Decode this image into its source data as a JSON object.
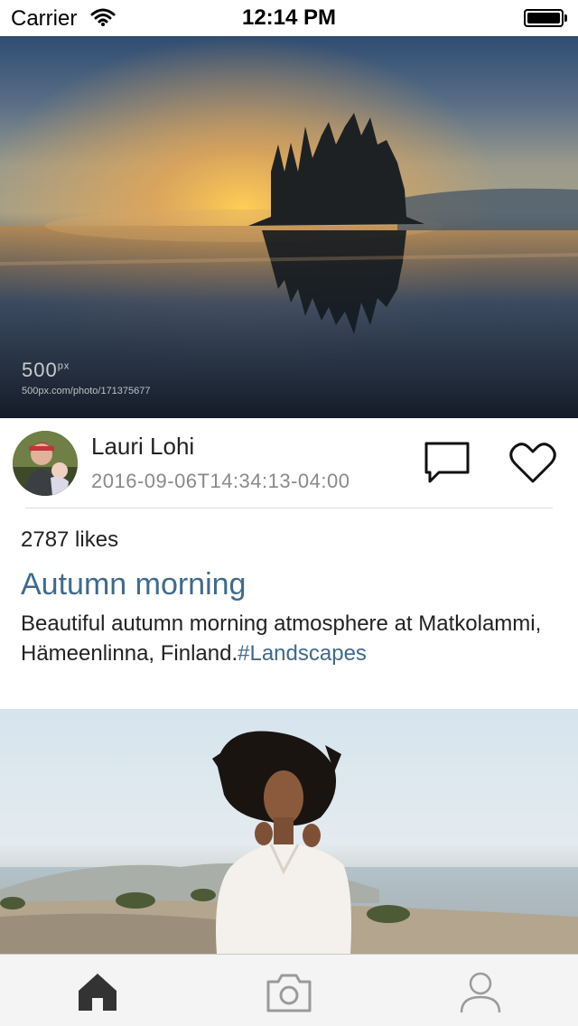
{
  "status_bar": {
    "carrier": "Carrier",
    "time": "12:14 PM"
  },
  "post": {
    "watermark_logo": "500",
    "watermark_logo_sup": "px",
    "watermark_url": "500px.com/photo/171375677",
    "author": "Lauri Lohi",
    "timestamp": "2016-09-06T14:34:13-04:00",
    "likes": "2787 likes",
    "title": "Autumn morning",
    "caption_text": "Beautiful autumn morning atmosphere at Matkolammi, Hämeenlinna, Finland.",
    "caption_tag": "#Landscapes"
  },
  "tab_bar": {
    "items": [
      "home-icon",
      "camera-icon",
      "profile-icon"
    ],
    "active": "home-icon"
  },
  "colors": {
    "accent": "#3f6a8c",
    "secondary_text": "#8a8a8a",
    "active_tab": "#333333",
    "inactive_tab": "#9a9a9a"
  }
}
